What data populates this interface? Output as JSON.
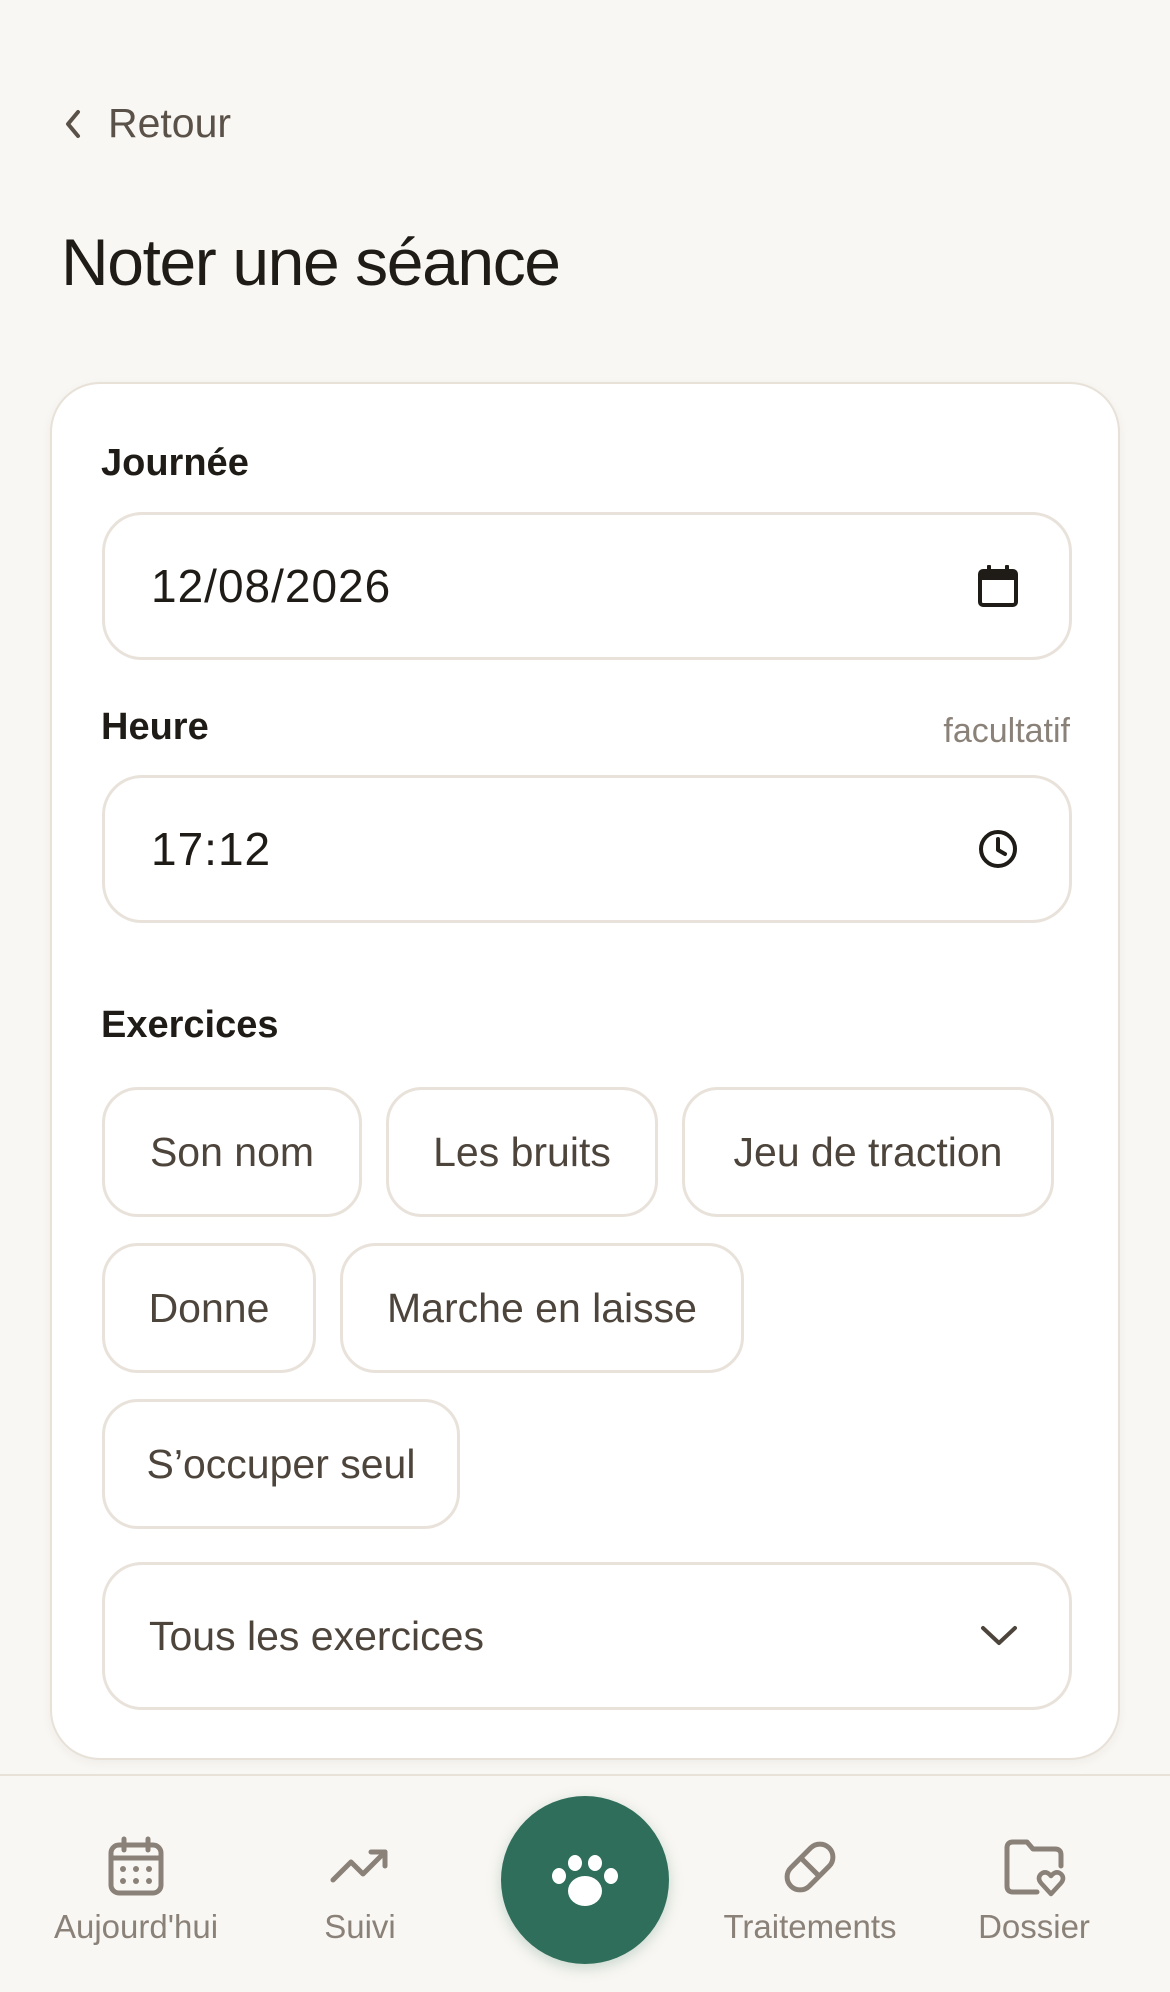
{
  "header": {
    "back_label": "Retour",
    "title": "Noter une séance"
  },
  "form": {
    "day_label": "Journée",
    "day_value": "12/08/2026",
    "time_label": "Heure",
    "time_optional": "facultatif",
    "time_value": "17:12",
    "exercises_label": "Exercices",
    "exercises": [
      "Son nom",
      "Les bruits",
      "Jeu de traction",
      "Donne",
      "Marche en laisse",
      "S’occuper seul"
    ],
    "all_exercises_label": "Tous les exercices"
  },
  "nav": {
    "items": [
      {
        "label": "Aujourd'hui",
        "icon": "calendar-icon"
      },
      {
        "label": "Suivi",
        "icon": "trend-icon"
      },
      {
        "label": "",
        "icon": "paw-icon"
      },
      {
        "label": "Traitements",
        "icon": "pill-icon"
      },
      {
        "label": "Dossier",
        "icon": "folder-heart-icon"
      }
    ]
  },
  "colors": {
    "background": "#f9f7f3",
    "accent": "#2e6e5a",
    "muted_text": "#8a8178",
    "border": "#e8e2da"
  }
}
